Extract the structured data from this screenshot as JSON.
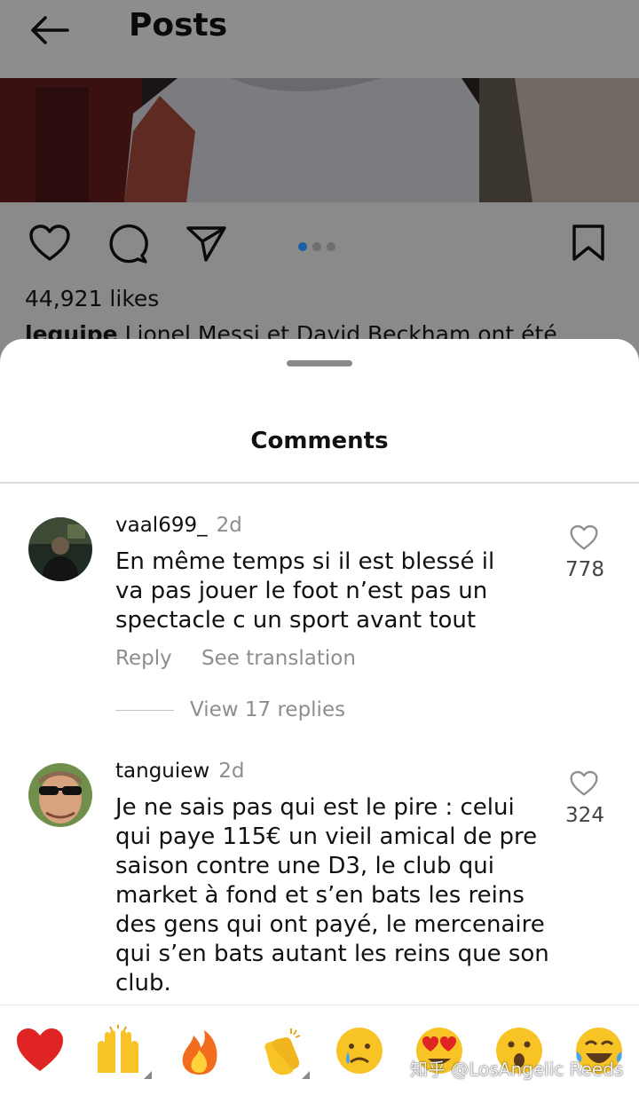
{
  "header": {
    "title": "Posts"
  },
  "post": {
    "likes": "44,921 likes",
    "caption_user": "lequipe",
    "caption_text": "Lionel Messi et David Beckham ont été",
    "carousel_dots": 3,
    "active_dot": 1
  },
  "sheet": {
    "title": "Comments"
  },
  "comments": [
    {
      "username": "vaal699_",
      "time": "2d",
      "lines": [
        "En même temps si il est blessé il",
        "va pas jouer le foot n’est pas un",
        "spectacle c un sport avant tout"
      ],
      "likes": "778",
      "reply_label": "Reply",
      "translate_label": "See translation",
      "view_replies": "View 17 replies"
    },
    {
      "username": "tanguiew",
      "time": "2d",
      "lines": [
        "Je ne sais pas qui est le pire : celui",
        "qui paye 115€ un vieil amical de pre",
        "saison contre une D3, le club qui",
        "market à fond et s’en bats les reins",
        "des gens qui ont payé, le mercenaire",
        "qui s’en bats autant les reins que son",
        "club."
      ],
      "likes": "324"
    }
  ],
  "emoji_bar": {
    "emojis": [
      "❤️",
      "🙌",
      "🔥",
      "👏",
      "😢",
      "😍",
      "😮",
      "😂"
    ],
    "icon_names": [
      "red-heart-emoji-icon",
      "raising-hands-emoji-icon",
      "fire-emoji-icon",
      "clapping-hands-emoji-icon",
      "crying-face-emoji-icon",
      "heart-eyes-emoji-icon",
      "surprised-face-emoji-icon",
      "tears-of-joy-emoji-icon"
    ]
  },
  "watermark": "知乎 @LosAngelic Reeds",
  "colors": {
    "accent_blue": "#1b5fa6",
    "heart_red": "#e02424",
    "muted_text": "#8e8e8e"
  }
}
